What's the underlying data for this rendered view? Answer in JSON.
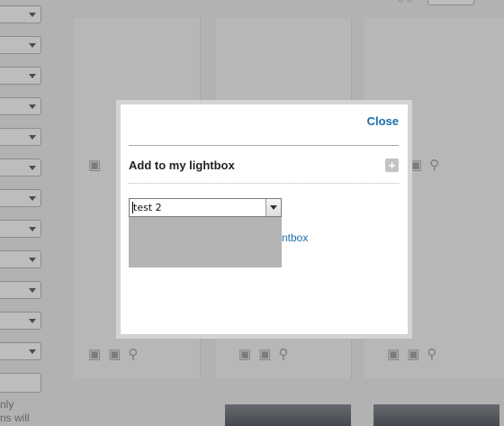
{
  "modal": {
    "close_label": "Close",
    "title": "Add to my lightbox",
    "add_icon": "plus-icon",
    "lightbox_select": {
      "selected_value": "test 2"
    },
    "create_link_label": "ntbox"
  },
  "background": {
    "filter_note": "nly\nns will",
    "tile_icons": [
      "download-icon",
      "add-to-lightbox-icon",
      "zoom-icon"
    ]
  },
  "colors": {
    "link": "#1c6fae",
    "overlay": "rgba(0,0,0,0.26)"
  }
}
